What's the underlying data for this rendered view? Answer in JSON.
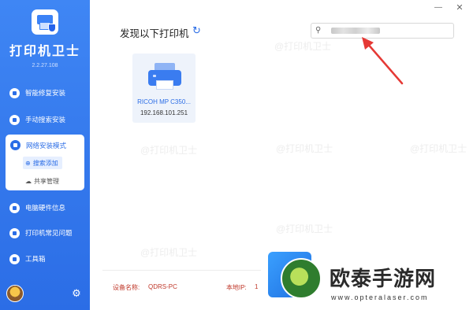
{
  "app": {
    "title": "打印机卫士",
    "version": "2.2.27.108"
  },
  "sidebar": {
    "items": [
      {
        "label": "智能修复安装",
        "icon": "wrench-icon"
      },
      {
        "label": "手动搜索安装",
        "icon": "search-icon"
      },
      {
        "label": "网络安装模式",
        "icon": "network-icon"
      },
      {
        "label": "电脑硬件信息",
        "icon": "hardware-icon"
      },
      {
        "label": "打印机常见问题",
        "icon": "help-icon"
      },
      {
        "label": "工具箱",
        "icon": "toolbox-icon"
      }
    ],
    "subitems": [
      {
        "label": "搜索添加",
        "icon": "plus-circle-icon",
        "active": true
      },
      {
        "label": "共享管理",
        "icon": "cloud-icon",
        "active": false
      }
    ]
  },
  "main": {
    "title": "发现以下打印机",
    "search": {
      "placeholder": ""
    },
    "printers": [
      {
        "name": "RICOH MP C350...",
        "ip": "192.168.101.251"
      }
    ]
  },
  "footer": {
    "device_label": "设备名称:",
    "device_value": "QDRS-PC",
    "ip_label": "本地IP:",
    "ip_value": "1"
  },
  "watermark": "@打印机卫士",
  "promo": {
    "text": "欧泰手游网",
    "url": "www.opteralaser.com"
  },
  "colors": {
    "sidebar": "#2b6de6",
    "accent": "#2b6de6",
    "footer_text": "#c0392b",
    "arrow": "#e53935"
  }
}
